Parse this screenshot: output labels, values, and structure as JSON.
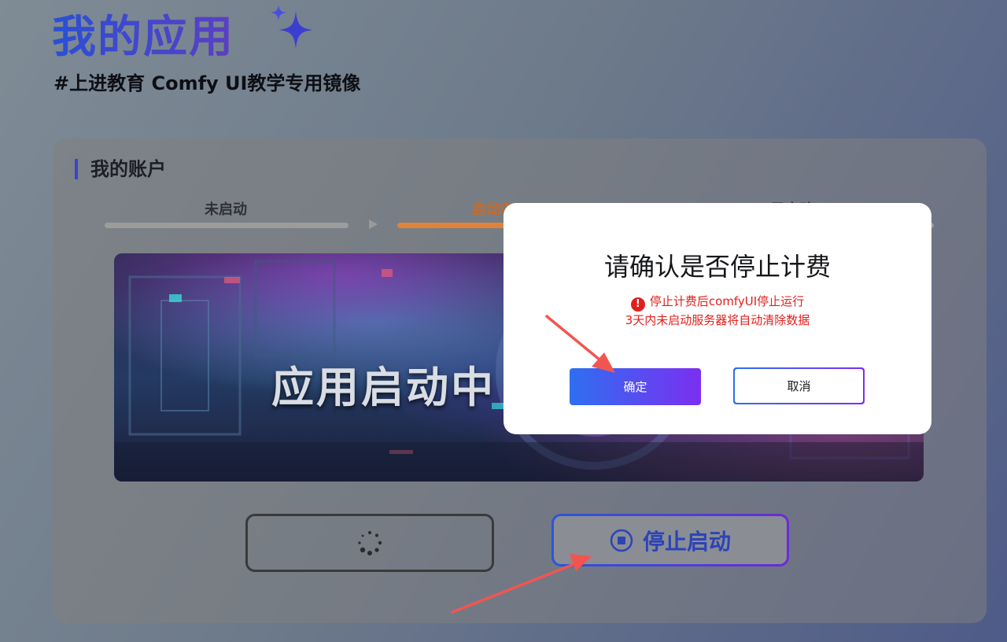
{
  "header": {
    "title": "我的应用",
    "subtitle": "#上进教育 Comfy UI教学专用镜像"
  },
  "account": {
    "section_title": "我的账户",
    "steps": [
      {
        "label": "未启动",
        "state": "done"
      },
      {
        "label": "启动中",
        "state": "active"
      },
      {
        "label": "已启动",
        "state": "pending"
      }
    ]
  },
  "banner": {
    "text": "应用启动中"
  },
  "actions": {
    "stop_label": "停止启动"
  },
  "dialog": {
    "title": "请确认是否停止计费",
    "warning_line1": "停止计费后comfyUI停止运行",
    "warning_line2": "3天内未启动服务器将自动清除数据",
    "confirm_label": "确定",
    "cancel_label": "取消"
  },
  "colors": {
    "accent_blue": "#2a56d8",
    "accent_purple": "#6a2bd9",
    "warning_red": "#e0201c",
    "active_step": "#e88a3c"
  }
}
